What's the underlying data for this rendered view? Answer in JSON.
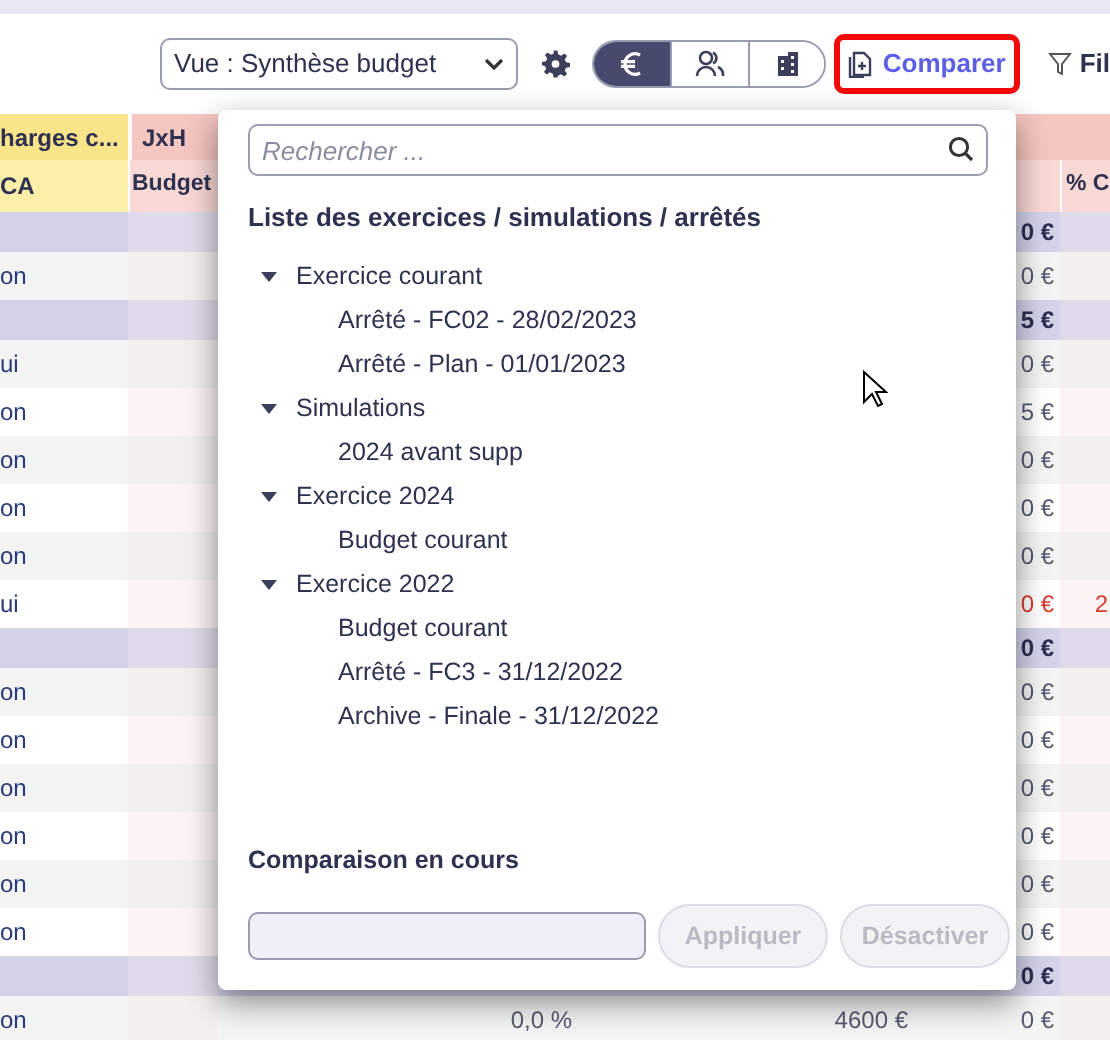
{
  "toolbar": {
    "view_select": {
      "value": "Vue : Synthèse budget"
    },
    "mode_toggle": [
      {
        "kind": "euro",
        "selected": true
      },
      {
        "kind": "people",
        "selected": false
      },
      {
        "kind": "building",
        "selected": false
      }
    ],
    "compare_button": {
      "label": "Comparer",
      "highlighted": true
    },
    "filter_button": {
      "label": "Fil"
    }
  },
  "table": {
    "header_row_1": [
      {
        "text": "harges c...",
        "color": "#fbe58a"
      },
      {
        "text": "JxH",
        "color": "#f6c6c1"
      }
    ],
    "header_row_2": [
      {
        "text": "CA",
        "color": "#fcefa9"
      },
      {
        "text": "Budget",
        "color": "#f9d9d5"
      },
      {
        "text": "% C",
        "color": "#f9d9d5"
      }
    ],
    "rows": [
      {
        "kind": "group",
        "column_5": "0 €"
      },
      {
        "kind": "data",
        "column_1": "on",
        "column_5": "0 €"
      },
      {
        "kind": "group",
        "column_5": "5 €"
      },
      {
        "kind": "data",
        "column_1": "ui",
        "column_5": "0 €"
      },
      {
        "kind": "data",
        "column_1": "on",
        "column_5": "5 €"
      },
      {
        "kind": "data",
        "column_1": "on",
        "column_5": "0 €"
      },
      {
        "kind": "data",
        "column_1": "on",
        "column_5": "0 €"
      },
      {
        "kind": "data",
        "column_1": "on",
        "column_5": "0 €"
      },
      {
        "kind": "data",
        "column_1": "ui",
        "column_5": "0 €",
        "column_6": "2",
        "negative": true
      },
      {
        "kind": "group",
        "column_5": "0 €"
      },
      {
        "kind": "data",
        "column_1": "on",
        "column_5": "0 €"
      },
      {
        "kind": "data",
        "column_1": "on",
        "column_5": "0 €"
      },
      {
        "kind": "data",
        "column_1": "on",
        "column_5": "0 €"
      },
      {
        "kind": "data",
        "column_1": "on",
        "column_5": "0 €"
      },
      {
        "kind": "data",
        "column_1": "on",
        "column_5": "0 €"
      },
      {
        "kind": "data",
        "column_1": "on",
        "column_5": "0 €"
      },
      {
        "kind": "group",
        "column_5": "0 €"
      },
      {
        "kind": "data",
        "column_1": "on",
        "column_3": "0,0 %",
        "column_4": "4600 €",
        "column_5": "0 €"
      }
    ]
  },
  "compare_popup": {
    "search": {
      "placeholder": "Rechercher ..."
    },
    "list_title": "Liste des exercices / simulations / arrêtés",
    "tree": [
      {
        "label": "Exercice courant",
        "expanded": true,
        "children": [
          {
            "label": "Arrêté - FC02 - 28/02/2023"
          },
          {
            "label": "Arrêté - Plan - 01/01/2023"
          }
        ]
      },
      {
        "label": "Simulations",
        "expanded": true,
        "children": [
          {
            "label": "2024 avant supp"
          }
        ]
      },
      {
        "label": "Exercice 2024",
        "expanded": true,
        "children": [
          {
            "label": "Budget courant"
          }
        ]
      },
      {
        "label": "Exercice 2022",
        "expanded": true,
        "children": [
          {
            "label": "Budget courant"
          },
          {
            "label": "Arrêté - FC3 - 31/12/2022"
          },
          {
            "label": "Archive - Finale - 31/12/2022"
          }
        ]
      }
    ],
    "current_title": "Comparaison en cours",
    "buttons": [
      {
        "label": "Appliquer",
        "disabled": true
      },
      {
        "label": "Désactiver",
        "disabled": true
      }
    ]
  }
}
